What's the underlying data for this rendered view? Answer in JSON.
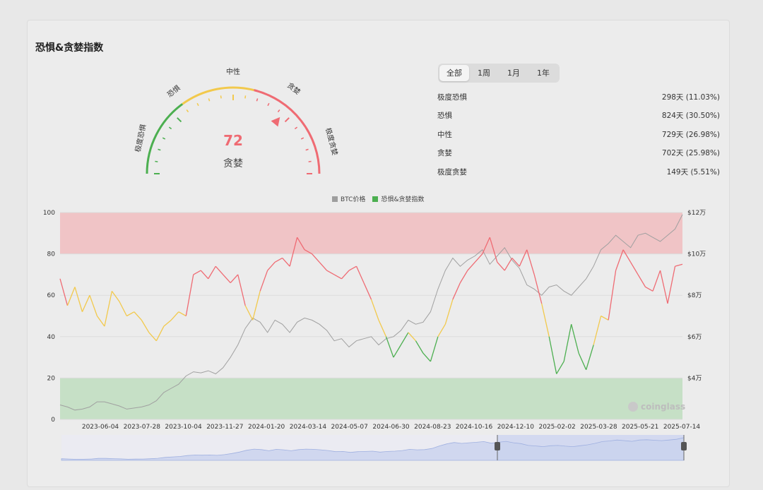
{
  "title": "恐惧&贪婪指数",
  "gauge": {
    "value": "72",
    "label": "贪婪",
    "zones": [
      "极度恐惧",
      "恐惧",
      "中性",
      "贪婪",
      "极度贪婪"
    ],
    "level": 0.72
  },
  "tabs": [
    {
      "label": "全部",
      "active": true
    },
    {
      "label": "1周",
      "active": false
    },
    {
      "label": "1月",
      "active": false
    },
    {
      "label": "1年",
      "active": false
    }
  ],
  "stats": [
    {
      "label": "极度恐惧",
      "value": "298天 (11.03%)"
    },
    {
      "label": "恐惧",
      "value": "824天 (30.50%)"
    },
    {
      "label": "中性",
      "value": "729天 (26.98%)"
    },
    {
      "label": "贪婪",
      "value": "702天 (25.98%)"
    },
    {
      "label": "极度贪婪",
      "value": "149天 (5.51%)"
    }
  ],
  "colors": {
    "fear": "#4caf50",
    "neutral": "#f2c94c",
    "greed": "#ef6b73",
    "btc": "#a0a0a0",
    "extreme_greed_band": "#f0c4c6",
    "extreme_fear_band": "#c6e0c6"
  },
  "watermark": "coinglass",
  "chart_data": {
    "type": "line",
    "legend": [
      "BTC价格",
      "恐惧&贪婪指数"
    ],
    "x_ticks": [
      "2023-06-04",
      "2023-07-28",
      "2023-10-04",
      "2023-11-27",
      "2024-01-20",
      "2024-03-14",
      "2024-05-07",
      "2024-06-30",
      "2024-08-23",
      "2024-10-16",
      "2024-12-10",
      "2025-02-02",
      "2025-03-28",
      "2025-05-21",
      "2025-07-14"
    ],
    "y_left_ticks": [
      "100",
      "80",
      "60",
      "40",
      "20",
      "0"
    ],
    "y_right_ticks": [
      "$12万",
      "$10万",
      "$8万",
      "$6万",
      "$4万"
    ],
    "ylim_left": [
      0,
      100
    ],
    "ylim_right": [
      2,
      12
    ],
    "right_unit": "万美元",
    "series": [
      {
        "name": "恐惧&贪婪指数",
        "axis": "left",
        "values": [
          68,
          55,
          64,
          52,
          60,
          50,
          45,
          62,
          57,
          50,
          52,
          48,
          42,
          38,
          45,
          48,
          52,
          50,
          70,
          72,
          68,
          74,
          70,
          66,
          70,
          55,
          48,
          62,
          72,
          76,
          78,
          74,
          88,
          82,
          80,
          76,
          72,
          70,
          68,
          72,
          74,
          66,
          58,
          48,
          40,
          30,
          36,
          42,
          38,
          32,
          28,
          40,
          46,
          58,
          66,
          72,
          76,
          80,
          88,
          76,
          72,
          78,
          74,
          82,
          70,
          56,
          40,
          22,
          28,
          46,
          32,
          24,
          36,
          50,
          48,
          72,
          82,
          76,
          70,
          64,
          62,
          72,
          56,
          74,
          75
        ]
      },
      {
        "name": "BTC价格",
        "axis": "right",
        "values": [
          2.7,
          2.6,
          2.45,
          2.5,
          2.6,
          2.85,
          2.85,
          2.75,
          2.65,
          2.5,
          2.55,
          2.6,
          2.7,
          2.9,
          3.3,
          3.5,
          3.7,
          4.1,
          4.3,
          4.25,
          4.35,
          4.2,
          4.5,
          5.0,
          5.6,
          6.4,
          6.9,
          6.7,
          6.2,
          6.8,
          6.6,
          6.2,
          6.7,
          6.9,
          6.8,
          6.6,
          6.3,
          5.8,
          5.9,
          5.5,
          5.8,
          5.9,
          6.0,
          5.6,
          5.9,
          6.0,
          6.3,
          6.8,
          6.6,
          6.7,
          7.2,
          8.3,
          9.2,
          9.8,
          9.4,
          9.7,
          9.9,
          10.2,
          9.5,
          9.9,
          10.3,
          9.7,
          9.3,
          8.5,
          8.3,
          8.0,
          8.4,
          8.5,
          8.2,
          8.0,
          8.4,
          8.8,
          9.4,
          10.2,
          10.5,
          10.9,
          10.6,
          10.3,
          10.9,
          11.0,
          10.8,
          10.6,
          10.9,
          11.2,
          11.9
        ]
      }
    ]
  }
}
